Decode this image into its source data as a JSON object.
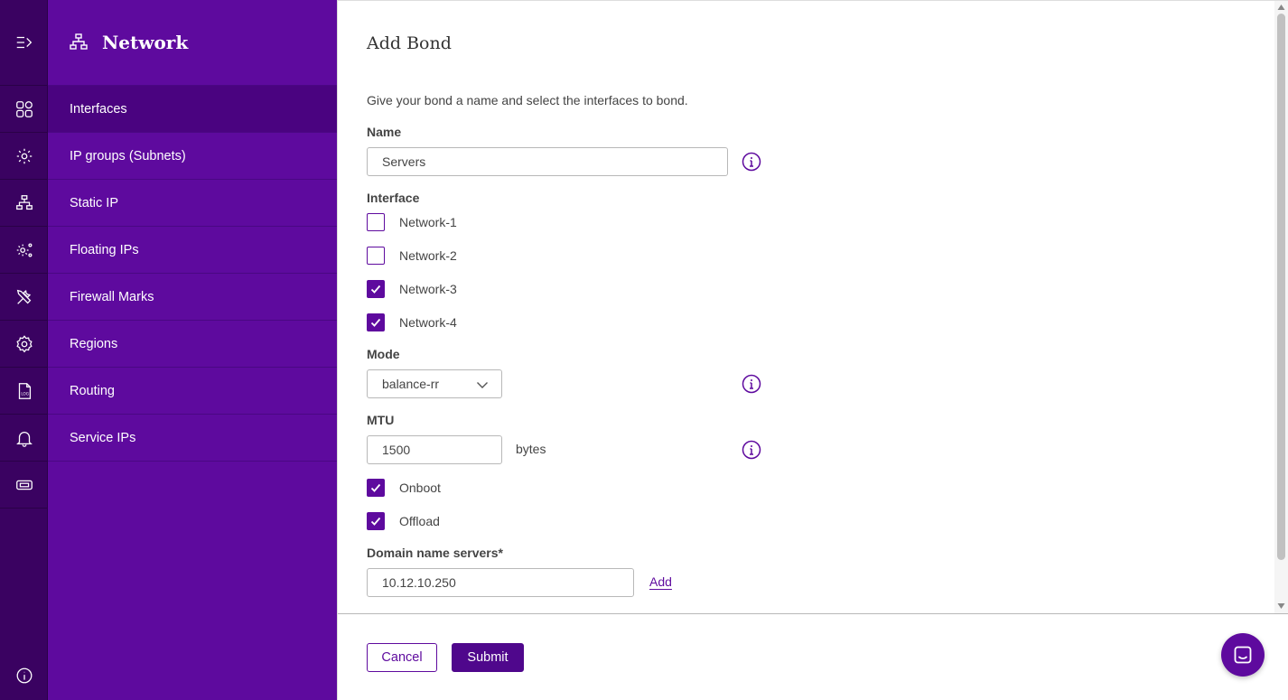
{
  "app": {
    "section_title": "Network"
  },
  "sidebar": {
    "items": [
      {
        "label": "Interfaces",
        "icon": "dashboard-grid-icon",
        "active": true
      },
      {
        "label": "IP groups (Subnets)",
        "icon": "gear-location-icon",
        "active": false
      },
      {
        "label": "Static IP",
        "icon": "network-icon",
        "active": false
      },
      {
        "label": "Floating IPs",
        "icon": "gear-nodes-icon",
        "active": false
      },
      {
        "label": "Firewall Marks",
        "icon": "tools-icon",
        "active": false
      },
      {
        "label": "Regions",
        "icon": "gear-icon",
        "active": false
      },
      {
        "label": "Routing",
        "icon": "log-file-icon",
        "active": false
      },
      {
        "label": "Service IPs",
        "icon": "bell-icon",
        "active": false
      }
    ],
    "extra_rail_icon": "ticket-icon"
  },
  "form": {
    "title": "Add Bond",
    "intro": "Give your bond a name and select the interfaces to bond.",
    "name_label": "Name",
    "name_value": "Servers",
    "interface_label": "Interface",
    "interfaces": [
      {
        "label": "Network-1",
        "checked": false
      },
      {
        "label": "Network-2",
        "checked": false
      },
      {
        "label": "Network-3",
        "checked": true
      },
      {
        "label": "Network-4",
        "checked": true
      }
    ],
    "mode_label": "Mode",
    "mode_value": "balance-rr",
    "mtu_label": "MTU",
    "mtu_value": "1500",
    "mtu_unit": "bytes",
    "onboot_label": "Onboot",
    "onboot_checked": true,
    "offload_label": "Offload",
    "offload_checked": true,
    "dns_label": "Domain name servers*",
    "dns_value": "10.12.10.250",
    "dns_add_label": "Add"
  },
  "footer": {
    "cancel_label": "Cancel",
    "submit_label": "Submit"
  },
  "colors": {
    "rail": "#3a0261",
    "sidebar": "#5e0a9e",
    "sidebar_active": "#4a0380",
    "accent": "#5e0a9e"
  }
}
